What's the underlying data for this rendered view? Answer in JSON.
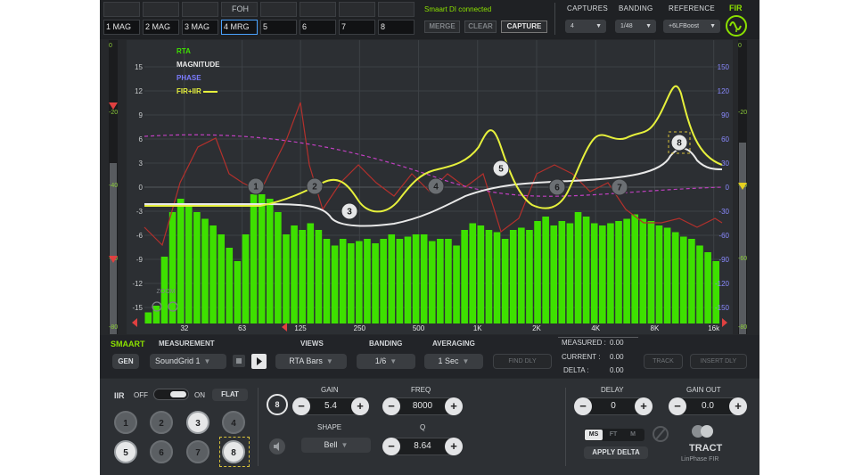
{
  "top": {
    "foh_label": "FOH",
    "slots": [
      "1 MAG",
      "2 MAG",
      "3 MAG",
      "4 MRG",
      "5",
      "6",
      "7",
      "8"
    ],
    "status": "Smaart DI connected",
    "merge": "MERGE",
    "clear": "CLEAR",
    "capture": "CAPTURE",
    "captures_label": "CAPTURES",
    "captures_value": "4",
    "banding_label": "BANDING",
    "banding_value": "1/48",
    "reference_label": "REFERENCE",
    "reference_value": "+6LFBoost",
    "fir_label": "FIR"
  },
  "graph": {
    "legend": {
      "rta": "RTA",
      "magnitude": "MAGNITUDE",
      "phase": "PHASE",
      "firiir": "FIR+IIR"
    },
    "left_ticks": [
      "15",
      "12",
      "9",
      "6",
      "3",
      "0",
      "-3",
      "-6",
      "-9",
      "-12",
      "-15"
    ],
    "right_ticks": [
      "150",
      "120",
      "90",
      "60",
      "30",
      "0",
      "-30",
      "-60",
      "-90",
      "-120",
      "-150"
    ],
    "meter_ticks": [
      "0",
      "-20",
      "-40",
      "-60",
      "-80"
    ],
    "freq_ticks": [
      "32",
      "63",
      "125",
      "250",
      "500",
      "1K",
      "2K",
      "4K",
      "8K",
      "16k"
    ],
    "zoom_label": "ZOOM",
    "nodes": [
      {
        "id": "1",
        "freq_hz": 50,
        "gain_db": 0
      },
      {
        "id": "2",
        "freq_hz": 120,
        "gain_db": 0
      },
      {
        "id": "3",
        "freq_hz": 200,
        "gain_db": -2
      },
      {
        "id": "4",
        "freq_hz": 500,
        "gain_db": 0
      },
      {
        "id": "5",
        "freq_hz": 1000,
        "gain_db": 2
      },
      {
        "id": "6",
        "freq_hz": 2000,
        "gain_db": 0
      },
      {
        "id": "7",
        "freq_hz": 4000,
        "gain_db": 0
      },
      {
        "id": "8",
        "freq_hz": 8000,
        "gain_db": 5.4
      }
    ],
    "colors": {
      "rta": "#3ee000",
      "magnitude": "#e8e8e8",
      "phase": "#7b7bff",
      "firiir": "#e6f03c",
      "trace_red": "#b3302c",
      "trace_magenta": "#c040c0"
    }
  },
  "measure": {
    "smaart": "SMAART",
    "measurement_label": "MEASUREMENT",
    "gen": "GEN",
    "source": "SoundGrid 1",
    "views_label": "VIEWS",
    "views_value": "RTA Bars",
    "banding_label": "BANDING",
    "banding_value": "1/6",
    "averaging_label": "AVERAGING",
    "averaging_value": "1 Sec",
    "find_dly": "FIND DLY",
    "measured_label": "MEASURED :",
    "measured_value": "0.00",
    "current_label": "CURRENT :",
    "current_value": "0.00",
    "delta_label": "DELTA :",
    "delta_value": "0.00",
    "track": "TRACK",
    "insert_dly": "INSERT DLY"
  },
  "eq": {
    "iir": "IIR",
    "off": "OFF",
    "on": "ON",
    "flat": "FLAT",
    "bands": [
      "1",
      "2",
      "3",
      "4",
      "5",
      "6",
      "7",
      "8"
    ],
    "selected_band": "8",
    "gain_label": "GAIN",
    "gain_value": "5.4",
    "freq_label": "FREQ",
    "freq_value": "8000",
    "shape_label": "SHAPE",
    "shape_value": "Bell",
    "q_label": "Q",
    "q_value": "8.64",
    "delay_label": "DELAY",
    "delay_value": "0",
    "gainout_label": "GAIN OUT",
    "gainout_value": "0.0",
    "units": [
      "MS",
      "FT",
      "M"
    ],
    "apply_delta": "APPLY DELTA",
    "brand": "TRACT",
    "brand_sub": "LinPhase FIR"
  }
}
